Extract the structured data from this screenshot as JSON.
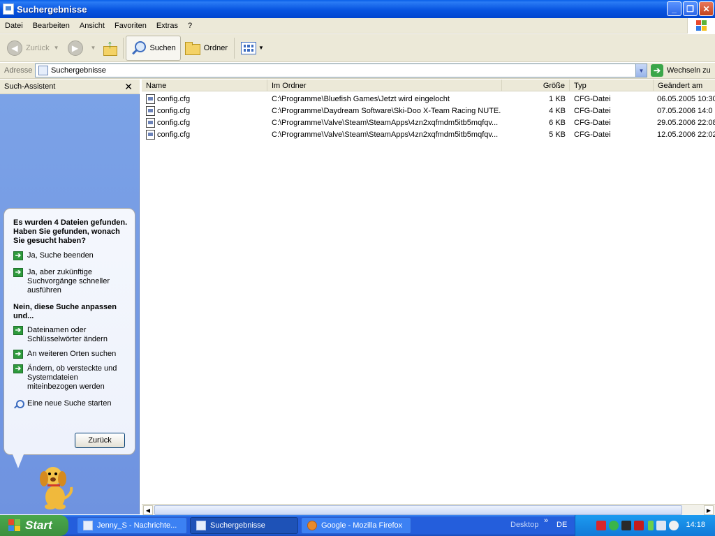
{
  "window": {
    "title": "Suchergebnisse",
    "minimize": "_",
    "restore": "❐",
    "close": "✕"
  },
  "menu": [
    "Datei",
    "Bearbeiten",
    "Ansicht",
    "Favoriten",
    "Extras",
    "?"
  ],
  "toolbar": {
    "back_label": "Zurück",
    "search_label": "Suchen",
    "folders_label": "Ordner"
  },
  "address": {
    "label": "Adresse",
    "value": "Suchergebnisse",
    "go_label": "Wechseln zu"
  },
  "pane": {
    "title": "Such-Assistent",
    "close": "✕",
    "question": "Es wurden 4 Dateien gefunden. Haben Sie gefunden, wonach Sie gesucht haben?",
    "options_yes": [
      "Ja, Suche beenden",
      "Ja, aber zukünftige Suchvorgänge schneller ausführen"
    ],
    "section_no": "Nein, diese Suche anpassen und...",
    "options_no": [
      "Dateinamen oder Schlüsselwörter ändern",
      "An weiteren Orten suchen",
      "Ändern, ob versteckte und Systemdateien miteinbezogen werden"
    ],
    "new_search": "Eine neue Suche starten",
    "back_button": "Zurück"
  },
  "columns": [
    "Name",
    "Im Ordner",
    "Größe",
    "Typ",
    "Geändert am"
  ],
  "files": [
    {
      "name": "config.cfg",
      "folder": "C:\\Programme\\Bluefish Games\\Jetzt wird eingelocht",
      "size": "1 KB",
      "type": "CFG-Datei",
      "modified": "06.05.2005 10:30"
    },
    {
      "name": "config.cfg",
      "folder": "C:\\Programme\\Daydream Software\\Ski-Doo X-Team Racing NUTE...",
      "size": "4 KB",
      "type": "CFG-Datei",
      "modified": "07.05.2006 14:0"
    },
    {
      "name": "config.cfg",
      "folder": "C:\\Programme\\Valve\\Steam\\SteamApps\\4zn2xqfmdm5itb5mqfqv...",
      "size": "6 KB",
      "type": "CFG-Datei",
      "modified": "29.05.2006 22:08"
    },
    {
      "name": "config.cfg",
      "folder": "C:\\Programme\\Valve\\Steam\\SteamApps\\4zn2xqfmdm5itb5mqfqv...",
      "size": "5 KB",
      "type": "CFG-Datei",
      "modified": "12.05.2006 22:02"
    }
  ],
  "taskbar": {
    "start": "Start",
    "tasks": [
      "Jenny_S - Nachrichte...",
      "Suchergebnisse",
      "Google - Mozilla Firefox"
    ],
    "desktop": "Desktop",
    "chevron": "»",
    "language": "DE",
    "clock": "14:18"
  }
}
